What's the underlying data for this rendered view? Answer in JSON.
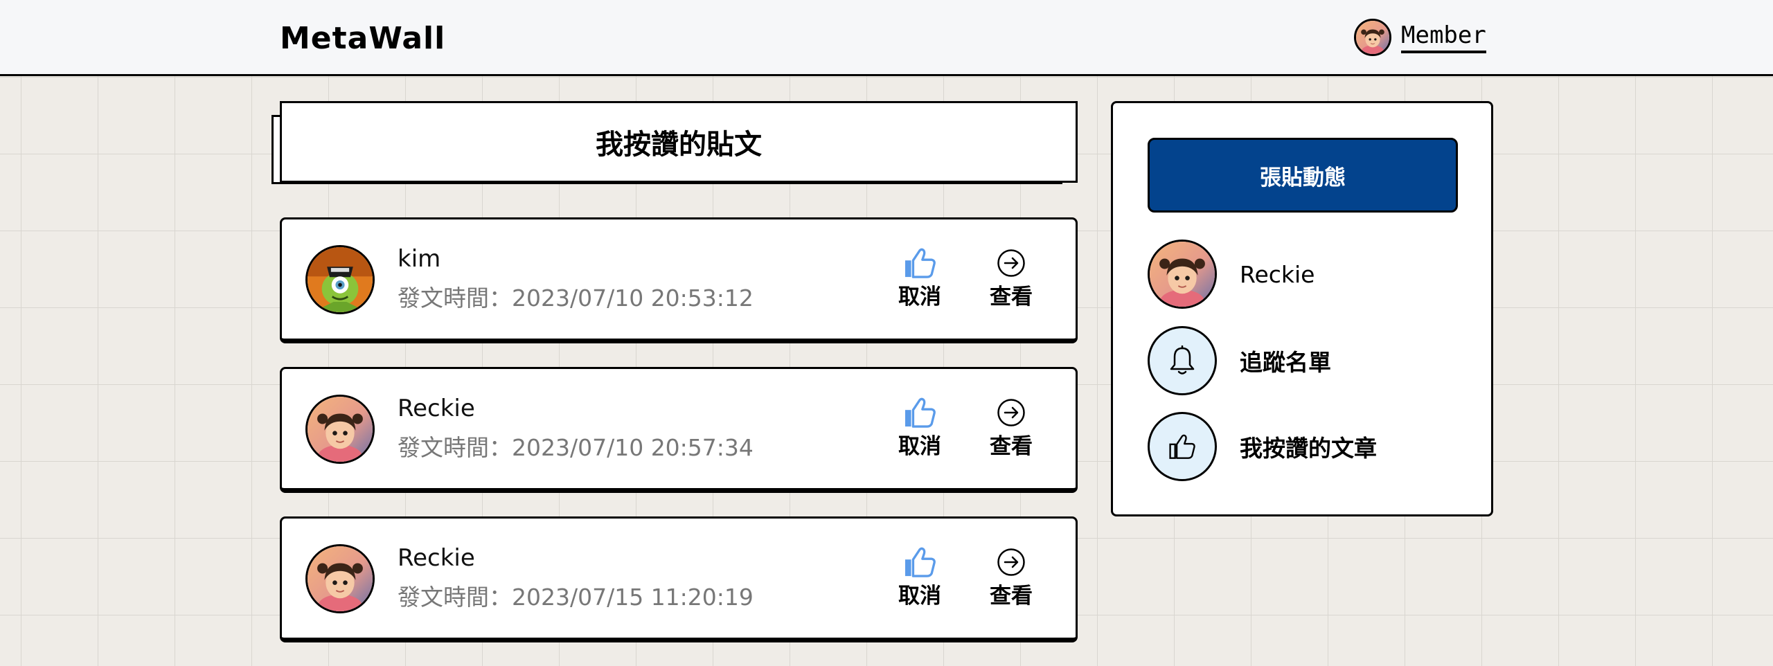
{
  "header": {
    "brand": "MetaWall",
    "member_label": "Member"
  },
  "page_title": "我按讚的貼文",
  "posts": [
    {
      "author": "kim",
      "time_label": "發文時間：2023/07/10 20:53:12",
      "avatar": "monster-avatar",
      "unlike_label": "取消",
      "view_label": "查看"
    },
    {
      "author": "Reckie",
      "time_label": "發文時間：2023/07/10 20:57:34",
      "avatar": "girl-avatar",
      "unlike_label": "取消",
      "view_label": "查看"
    },
    {
      "author": "Reckie",
      "time_label": "發文時間：2023/07/15 11:20:19",
      "avatar": "girl-avatar",
      "unlike_label": "取消",
      "view_label": "查看"
    }
  ],
  "sidebar": {
    "post_button": "張貼動態",
    "items": [
      {
        "label": "Reckie",
        "icon": "girl-avatar"
      },
      {
        "label": "追蹤名單",
        "icon": "bell-icon"
      },
      {
        "label": "我按讚的文章",
        "icon": "thumbs-up-icon"
      }
    ]
  },
  "colors": {
    "primary": "#03438d",
    "like_icon": "#5a9bea",
    "light_circle": "#e2f1fb",
    "background": "#efece7"
  }
}
